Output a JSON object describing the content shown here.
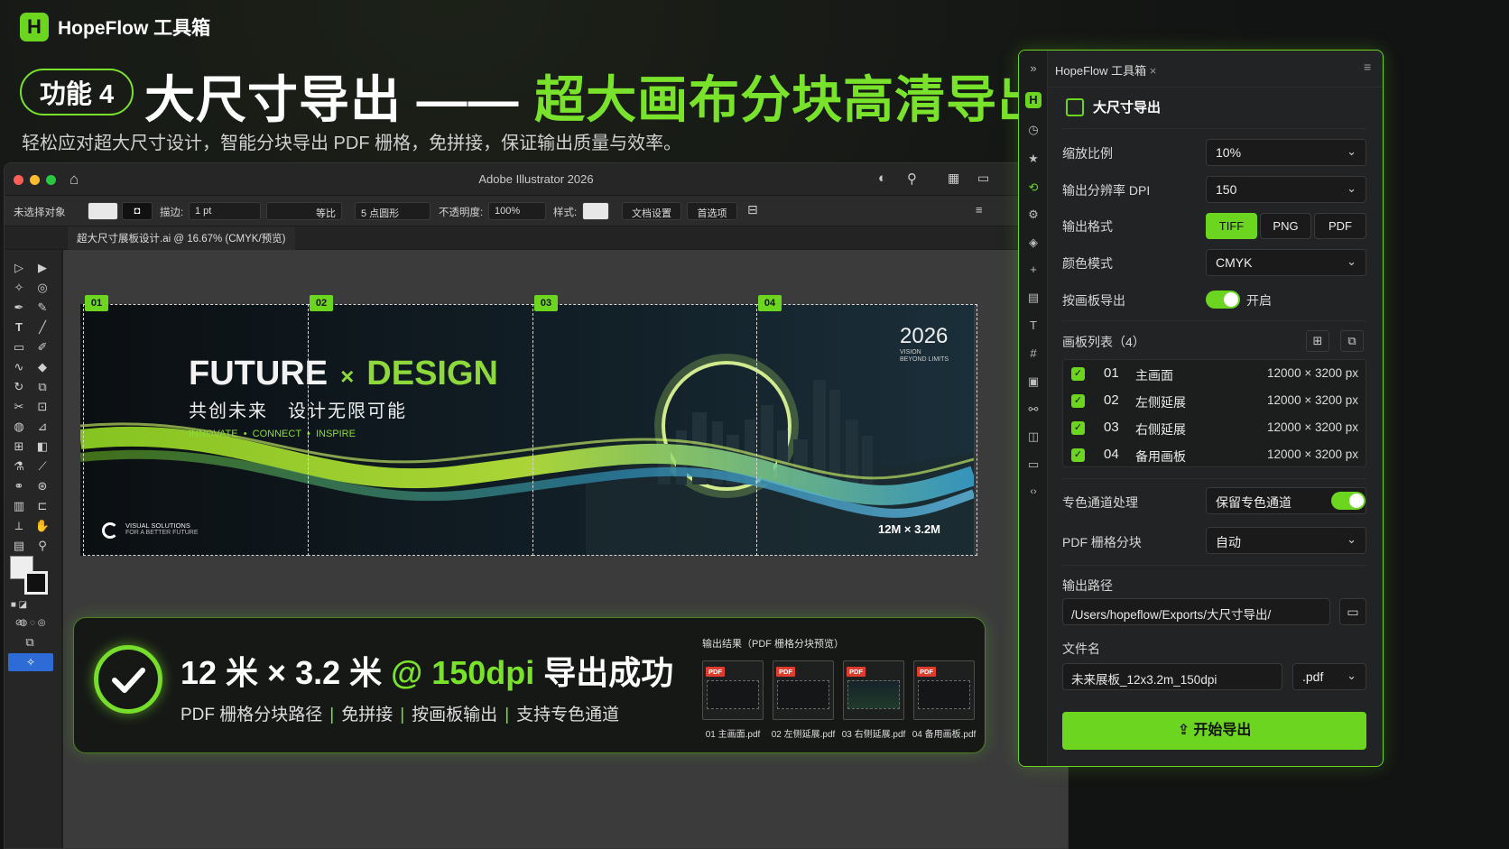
{
  "brand": {
    "logo_letter": "H",
    "name": "HopeFlow 工具箱"
  },
  "hero": {
    "badge": "功能 4",
    "title_white": "大尺寸导出 —— ",
    "title_green": "超大画布分块高清导出",
    "subtitle": "轻松应对超大尺寸设计，智能分块导出 PDF 栅格，免拼接，保证输出质量与效率。"
  },
  "ai": {
    "window_title": "Adobe Illustrator 2026",
    "control_bar": {
      "selection": "未选择对象",
      "stroke_label": "描边:",
      "stroke_value": "1 pt",
      "uniform": "等比",
      "brush": "5 点圆形",
      "opacity_label": "不透明度:",
      "opacity_value": "100%",
      "style_label": "样式:",
      "doc_setup": "文档设置",
      "prefs": "首选项"
    },
    "doc_tab": "超大尺寸展板设计.ai @ 16.67% (CMYK/预览)",
    "tiles": [
      "01",
      "02",
      "03",
      "04"
    ],
    "artwork": {
      "title_a": "FUTURE",
      "times": "×",
      "title_b": "DESIGN",
      "cn_tagline": "共创未来　设计无限可能",
      "tagline": "INNOVATE  •  CONNECT  •  INSPIRE",
      "year": "2026",
      "year_sub1": "VISION",
      "year_sub2": "BEYOND LIMITS",
      "brand_line1": "VISUAL SOLUTIONS",
      "brand_line2": "FOR A BETTER FUTURE",
      "size": "12M × 3.2M"
    }
  },
  "result": {
    "head_white": "12 米 × 3.2 米 ",
    "head_green": "@ 150dpi",
    "head_tail": " 导出成功",
    "features": [
      "PDF 栅格分块路径",
      "免拼接",
      "按画板输出",
      "支持专色通道"
    ],
    "preview_title": "输出结果（PDF 栅格分块预览）",
    "files": [
      {
        "badge": "PDF",
        "name": "01 主画面.pdf"
      },
      {
        "badge": "PDF",
        "name": "02 左侧延展.pdf"
      },
      {
        "badge": "PDF",
        "name": "03 右侧延展.pdf"
      },
      {
        "badge": "PDF",
        "name": "04 备用画板.pdf"
      }
    ]
  },
  "panel": {
    "tab": "HopeFlow 工具箱",
    "tab_close": "×",
    "menu": "≡",
    "heading": "大尺寸导出",
    "scale_label": "缩放比例",
    "scale_value": "10%",
    "dpi_label": "输出分辨率 DPI",
    "dpi_value": "150",
    "format_label": "输出格式",
    "formats": [
      "TIFF",
      "PNG",
      "PDF"
    ],
    "color_label": "颜色模式",
    "color_value": "CMYK",
    "by_artboard_label": "按画板导出",
    "by_artboard_state": "开启",
    "list_label": "画板列表（4）",
    "artboards": [
      {
        "num": "01",
        "name": "主画面",
        "size": "12000 × 3200 px"
      },
      {
        "num": "02",
        "name": "左侧延展",
        "size": "12000 × 3200 px"
      },
      {
        "num": "03",
        "name": "右侧延展",
        "size": "12000 × 3200 px"
      },
      {
        "num": "04",
        "name": "备用画板",
        "size": "12000 × 3200 px"
      }
    ],
    "spot_label": "专色通道处理",
    "spot_value": "保留专色通道",
    "tile_label": "PDF 栅格分块",
    "tile_value": "自动",
    "path_label": "输出路径",
    "path_value": "/Users/hopeflow/Exports/大尺寸导出/",
    "filename_label": "文件名",
    "filename_value": "未来展板_12x3.2m_150dpi",
    "ext_value": ".pdf",
    "export_button": "开始导出"
  },
  "colors": {
    "accent": "#6cd51f",
    "bg": "#121313",
    "panel": "#222324"
  }
}
